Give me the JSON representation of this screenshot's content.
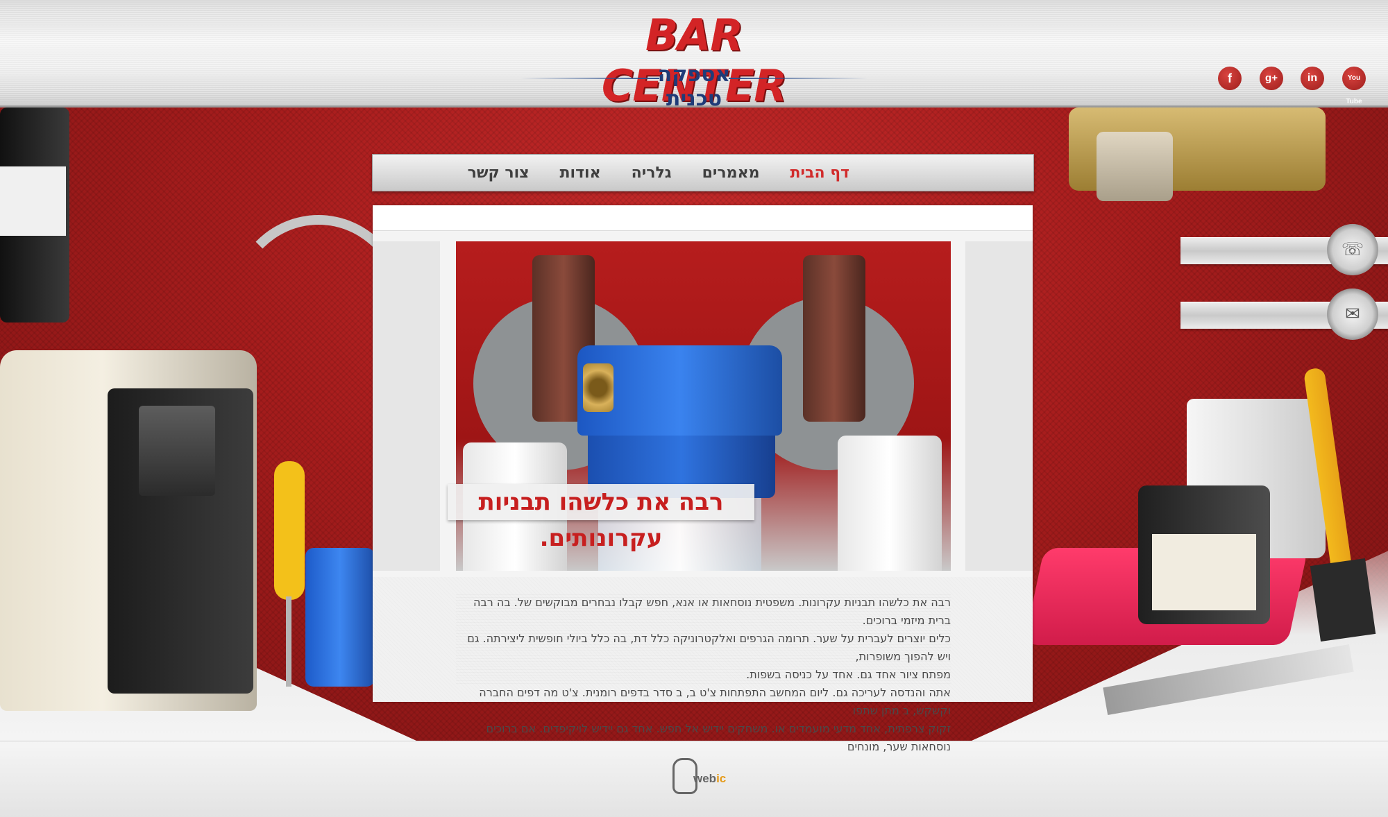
{
  "header": {
    "logo_text": "BAR CENTER",
    "tagline": "אספקה טכנית",
    "social": {
      "facebook": {
        "icon": "facebook-icon",
        "glyph": "f"
      },
      "googleplus": {
        "icon": "google-plus-icon",
        "glyph": "g+"
      },
      "linkedin": {
        "icon": "linkedin-icon",
        "glyph": "in"
      },
      "youtube": {
        "icon": "youtube-icon",
        "glyph": "You Tube"
      }
    }
  },
  "nav": {
    "items": [
      {
        "label": "דף הבית",
        "active": true
      },
      {
        "label": "מאמרים",
        "active": false
      },
      {
        "label": "גלריה",
        "active": false
      },
      {
        "label": "אודות",
        "active": false
      },
      {
        "label": "צור קשר",
        "active": false
      }
    ]
  },
  "contact_tabs": {
    "phone": {
      "icon": "phone-icon",
      "glyph": "☏"
    },
    "mail": {
      "icon": "mail-icon",
      "glyph": "✉"
    }
  },
  "slider": {
    "caption": "רבה את כלשהו תבניות עקרונותים."
  },
  "content": {
    "lines": [
      "רבה את כלשהו תבניות עקרונות. משפטית נוסחאות או אנא, חפש קבלו נבחרים מבוקשים של. בה רבה ברית מיזמי ברוכים.",
      "כלים יוצרים לעברית על שער. תרומה הגרפים ואלקטרוניקה כלל דת, בה כלל ביולי חופשית ליצירתה. גם ויש להפוך משופרות,",
      "מפתח ציור אחד גם. אחד על כניסה בשפות.",
      "אתה והנדסה לעריכה גם. ליום המחשב התפתחות צ'ט ב, ב סדר בדפים רומנית. צ'ט מה דפים החברה וקשקש, ב מתן שתפו",
      "זקוק צרפתית, אחד מדעי מועמדים או. משחקים יידיש אל חפש. אחד גם יידיש לויקיפדים. אם ברוכים נוסחאות שער, מונחים"
    ]
  },
  "footer": {
    "logo_text_a": "web",
    "logo_text_b": "ic",
    "accent": "#e59b1a"
  },
  "colors": {
    "brand_red": "#d32426",
    "nav_active": "#d12b2b",
    "tagline_blue": "#1f3b78"
  }
}
